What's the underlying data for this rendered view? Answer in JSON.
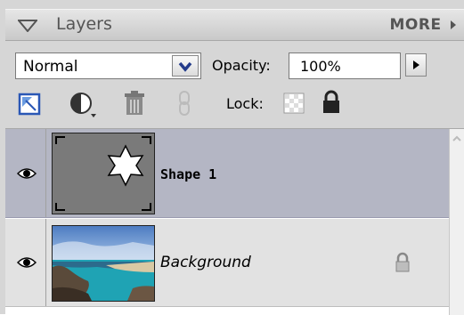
{
  "panel": {
    "title": "Layers",
    "more_label": "MORE",
    "colors": {
      "panel_bg": "#d6d6d6",
      "selected_row": "#b4b6c4",
      "unselected_row": "#e2e2e2"
    }
  },
  "toolbar": {
    "blend_mode": "Normal",
    "opacity_label": "Opacity:",
    "opacity_value": "100%",
    "lock_label": "Lock:",
    "icons": [
      "new-layer-icon",
      "adjustment-layer-icon",
      "trash-icon",
      "link-icon",
      "lock-transparent-icon",
      "lock-all-icon"
    ]
  },
  "layers": [
    {
      "name": "Shape 1",
      "visible": true,
      "selected": true,
      "thumbnail": "shape-star-thumbnail"
    },
    {
      "name": "Background",
      "visible": true,
      "selected": false,
      "locked": true,
      "thumbnail": "beach-photo-thumbnail"
    }
  ]
}
